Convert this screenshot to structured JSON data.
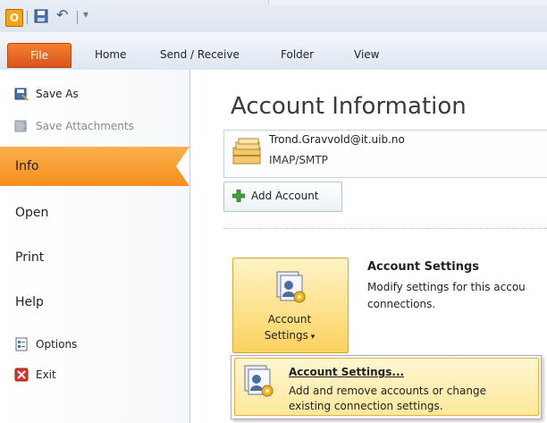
{
  "title_bar": {
    "app_icon_letter": "O"
  },
  "tabs": [
    {
      "label": "File"
    },
    {
      "label": "Home"
    },
    {
      "label": "Send / Receive"
    },
    {
      "label": "Folder"
    },
    {
      "label": "View"
    }
  ],
  "backstage": {
    "commands": [
      {
        "label": "Save As",
        "enabled": true
      },
      {
        "label": "Save Attachments",
        "enabled": false
      }
    ],
    "nav": [
      {
        "label": "Info",
        "selected": true
      },
      {
        "label": "Open"
      },
      {
        "label": "Print"
      },
      {
        "label": "Help"
      }
    ],
    "bottom_commands": [
      {
        "label": "Options"
      },
      {
        "label": "Exit"
      }
    ]
  },
  "main": {
    "title": "Account Information",
    "account": {
      "email": "Trond.Gravvold@it.uib.no",
      "type": "IMAP/SMTP"
    },
    "add_account_label": "Add Account",
    "account_settings": {
      "button_line1": "Account",
      "button_line2": "Settings",
      "section_title": "Account Settings",
      "section_desc_line1": "Modify settings for this accou",
      "section_desc_line2": "connections."
    },
    "dropdown": {
      "item_title": "Account Settings...",
      "item_desc_line1": "Add and remove accounts or change",
      "item_desc_line2": "existing connection settings."
    }
  },
  "colors": {
    "file_tab": "#e4642a",
    "selected_nav": "#f8a03a",
    "accent_button": "#fde28d"
  }
}
